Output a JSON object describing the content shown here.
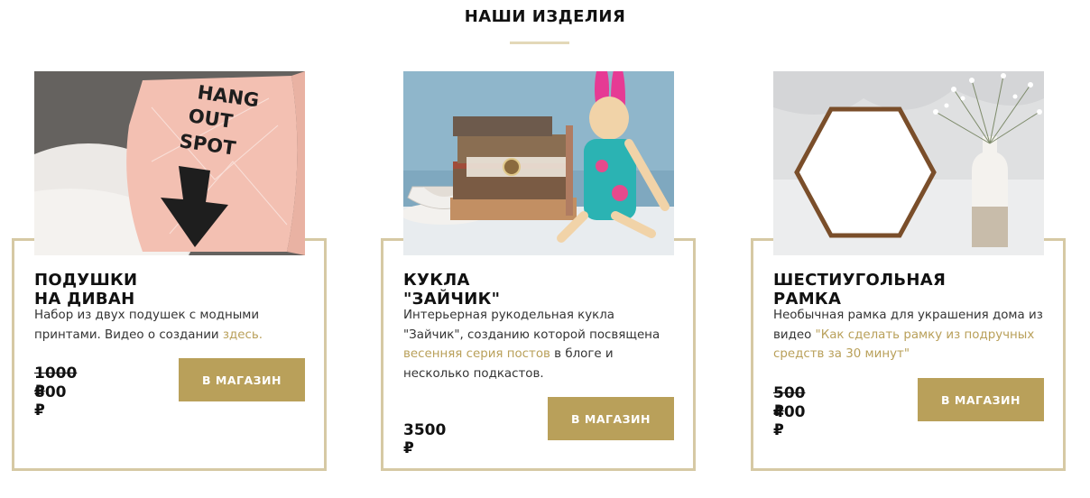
{
  "section": {
    "title": "НАШИ ИЗДЕЛИЯ"
  },
  "colors": {
    "accent": "#b9a05a",
    "frame": "#d6c9a4",
    "underline": "#e3d8b8"
  },
  "products": [
    {
      "name": "ПОДУШКИ НА ДИВАН",
      "image": "pillow-photo",
      "pillow_text": [
        "HANG",
        "OUT",
        "SPOT"
      ],
      "desc_parts": [
        "Набор из двух подушек с модными принтами. Видео о создании ",
        "здесь."
      ],
      "price_old": "1000 ₽",
      "price_new": "800 ₽",
      "button": "В МАГАЗИН"
    },
    {
      "name": "КУКЛА \"ЗАЙЧИК\"",
      "image": "bunny-doll-photo",
      "desc_parts": [
        "Интерьерная рукодельная кукла \"Зайчик\", созданию которой посвящена ",
        "весенняя серия постов",
        " в блоге и несколько подкастов."
      ],
      "price_new": "3500 ₽",
      "button": "В МАГАЗИН"
    },
    {
      "name": "ШЕСТИУГОЛЬНАЯ РАМКА",
      "image": "hexagon-frame-photo",
      "desc_parts": [
        "Необычная рамка для украшения дома из видео ",
        "\"Как сделать рамку из подручных средств за 30 минут\""
      ],
      "price_old": "500 ₽",
      "price_new": "400 ₽",
      "button": "В МАГАЗИН"
    }
  ]
}
